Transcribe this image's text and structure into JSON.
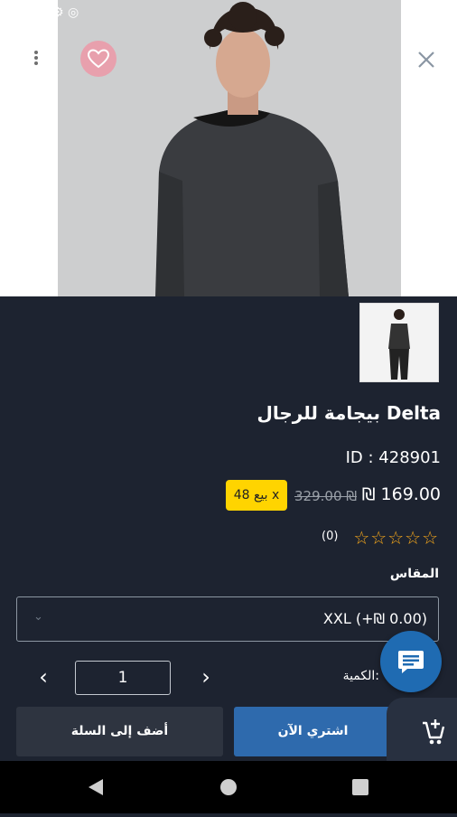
{
  "product": {
    "title": "Delta بيجامة للرجال",
    "id_text": "ID : 428901",
    "price": "₪ 169.00",
    "old_price": "329.00 ₪",
    "sale_badge": "بيع 48 x",
    "rating_stars": "☆☆☆☆☆",
    "reviews_count": "(0)"
  },
  "size": {
    "label": "المقاس",
    "selected": "XXL (+₪ 0.00)"
  },
  "quantity": {
    "label": "الكمية:",
    "value": "1"
  },
  "actions": {
    "add_to_cart": "أضف إلى السلة",
    "buy_now": "اشتري الآن"
  },
  "colors": {
    "background": "#1d2330",
    "accent_blue": "#2e6aad",
    "sale_yellow": "#ffd400",
    "star_orange": "#f3a61b"
  },
  "icons": {
    "close": "close-icon",
    "favorite": "heart-icon",
    "more": "more-vertical-icon",
    "chat": "chat-icon",
    "cart": "cart-add-icon"
  }
}
